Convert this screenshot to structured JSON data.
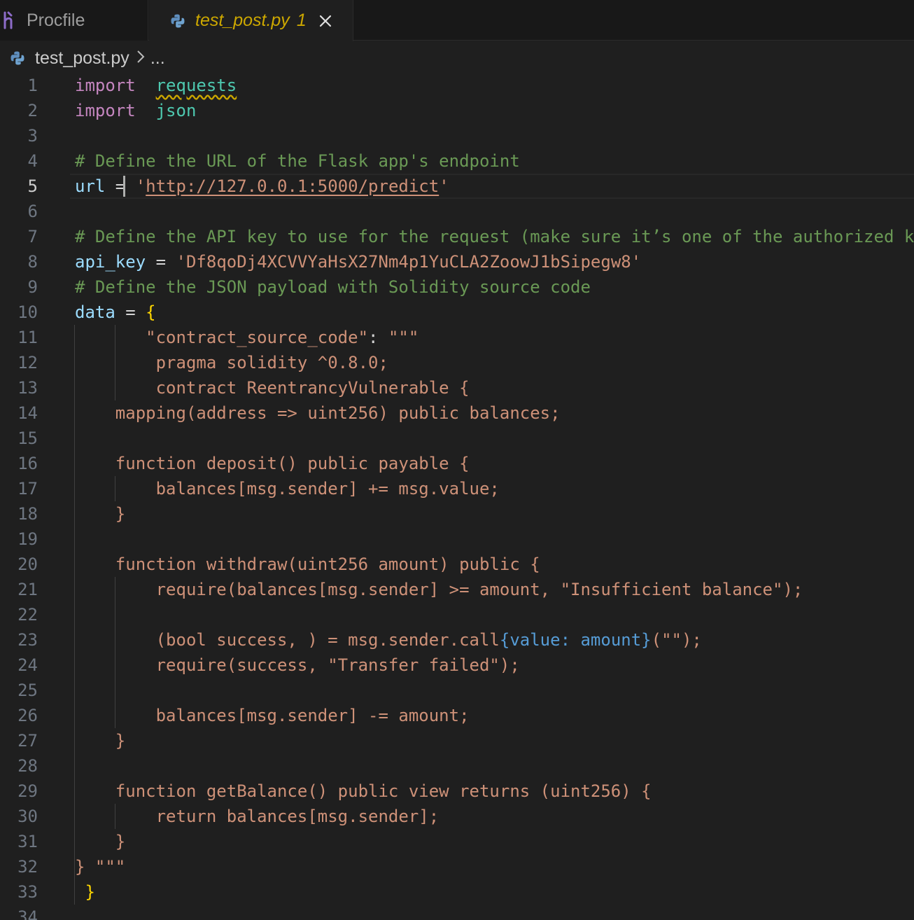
{
  "tabs": [
    {
      "label": "Procfile",
      "icon": "heroku-icon",
      "active": false
    },
    {
      "label": "test_post.py",
      "problem_count": "1",
      "icon": "python-icon",
      "active": true
    }
  ],
  "breadcrumb": {
    "file": "test_post.py",
    "more": "..."
  },
  "colors": {
    "keyword": "#c586c0",
    "module": "#4ec9b0",
    "comment": "#6a9955",
    "variable": "#9cdcfe",
    "string": "#ce9178",
    "brace": "#ffd700",
    "background": "#1f1f1f",
    "warning": "#cca700"
  },
  "editor": {
    "current_line": 5,
    "lines": [
      {
        "n": "1",
        "tokens": [
          [
            "kw",
            "import"
          ],
          [
            "",
            "  "
          ],
          [
            "mod sq",
            "requests"
          ]
        ]
      },
      {
        "n": "2",
        "tokens": [
          [
            "kw",
            "import"
          ],
          [
            "",
            "  "
          ],
          [
            "mod",
            "json"
          ]
        ]
      },
      {
        "n": "3",
        "tokens": []
      },
      {
        "n": "4",
        "tokens": [
          [
            "cm",
            "# Define the URL of the Flask app's endpoint"
          ]
        ]
      },
      {
        "n": "5",
        "tokens": [
          [
            "var",
            "url"
          ],
          [
            "op",
            " = "
          ],
          [
            "str",
            "'"
          ],
          [
            "str link",
            "http://127.0.0.1:5000/predict"
          ],
          [
            "str",
            "'"
          ]
        ]
      },
      {
        "n": "6",
        "tokens": []
      },
      {
        "n": "7",
        "tokens": [
          [
            "cm",
            "# Define the API key to use for the request (make sure it’s one of the authorized keys)"
          ]
        ]
      },
      {
        "n": "8",
        "tokens": [
          [
            "var",
            "api_key"
          ],
          [
            "op",
            " = "
          ],
          [
            "str",
            "'Df8qoDj4XCVVYaHsX27Nm4p1YuCLA2ZoowJ1bSipegw8'"
          ]
        ]
      },
      {
        "n": "9",
        "tokens": [
          [
            "cm",
            "# Define the JSON payload with Solidity source code"
          ]
        ]
      },
      {
        "n": "10",
        "tokens": [
          [
            "var",
            "data"
          ],
          [
            "op",
            " = "
          ],
          [
            "brace",
            "{"
          ]
        ]
      },
      {
        "n": "11",
        "tokens": [
          [
            "str",
            "       \"contract_source_code\""
          ],
          [
            "op",
            ": "
          ],
          [
            "str",
            "\"\"\""
          ]
        ]
      },
      {
        "n": "12",
        "tokens": [
          [
            "str",
            "        pragma solidity ^0.8.0;"
          ]
        ]
      },
      {
        "n": "13",
        "tokens": [
          [
            "str",
            "        contract ReentrancyVulnerable {"
          ]
        ]
      },
      {
        "n": "14",
        "tokens": [
          [
            "str",
            "    mapping(address => uint256) public balances;"
          ]
        ]
      },
      {
        "n": "15",
        "tokens": []
      },
      {
        "n": "16",
        "tokens": [
          [
            "str",
            "    function deposit() public payable {"
          ]
        ]
      },
      {
        "n": "17",
        "tokens": [
          [
            "str",
            "        balances[msg.sender] += msg.value;"
          ]
        ]
      },
      {
        "n": "18",
        "tokens": [
          [
            "str",
            "    }"
          ]
        ]
      },
      {
        "n": "19",
        "tokens": []
      },
      {
        "n": "20",
        "tokens": [
          [
            "str",
            "    function withdraw(uint256 amount) public {"
          ]
        ]
      },
      {
        "n": "21",
        "tokens": [
          [
            "str",
            "        require(balances[msg.sender] >= amount, \"Insufficient balance\");"
          ]
        ]
      },
      {
        "n": "22",
        "tokens": []
      },
      {
        "n": "23",
        "tokens": [
          [
            "str",
            "        (bool success, ) = msg.sender.call"
          ],
          [
            "blue",
            "{value: amount}"
          ],
          [
            "str",
            "(\"\");"
          ]
        ]
      },
      {
        "n": "24",
        "tokens": [
          [
            "str",
            "        require(success, \"Transfer failed\");"
          ]
        ]
      },
      {
        "n": "25",
        "tokens": []
      },
      {
        "n": "26",
        "tokens": [
          [
            "str",
            "        balances[msg.sender] -= amount;"
          ]
        ]
      },
      {
        "n": "27",
        "tokens": [
          [
            "str",
            "    }"
          ]
        ]
      },
      {
        "n": "28",
        "tokens": []
      },
      {
        "n": "29",
        "tokens": [
          [
            "str",
            "    function getBalance() public view returns (uint256) {"
          ]
        ]
      },
      {
        "n": "30",
        "tokens": [
          [
            "str",
            "        return balances[msg.sender];"
          ]
        ]
      },
      {
        "n": "31",
        "tokens": [
          [
            "str",
            "    }"
          ]
        ]
      },
      {
        "n": "32",
        "tokens": [
          [
            "str",
            "} \"\"\""
          ]
        ]
      },
      {
        "n": "33",
        "tokens": [
          [
            "brace",
            " }"
          ]
        ]
      },
      {
        "n": "34",
        "tokens": []
      }
    ]
  }
}
